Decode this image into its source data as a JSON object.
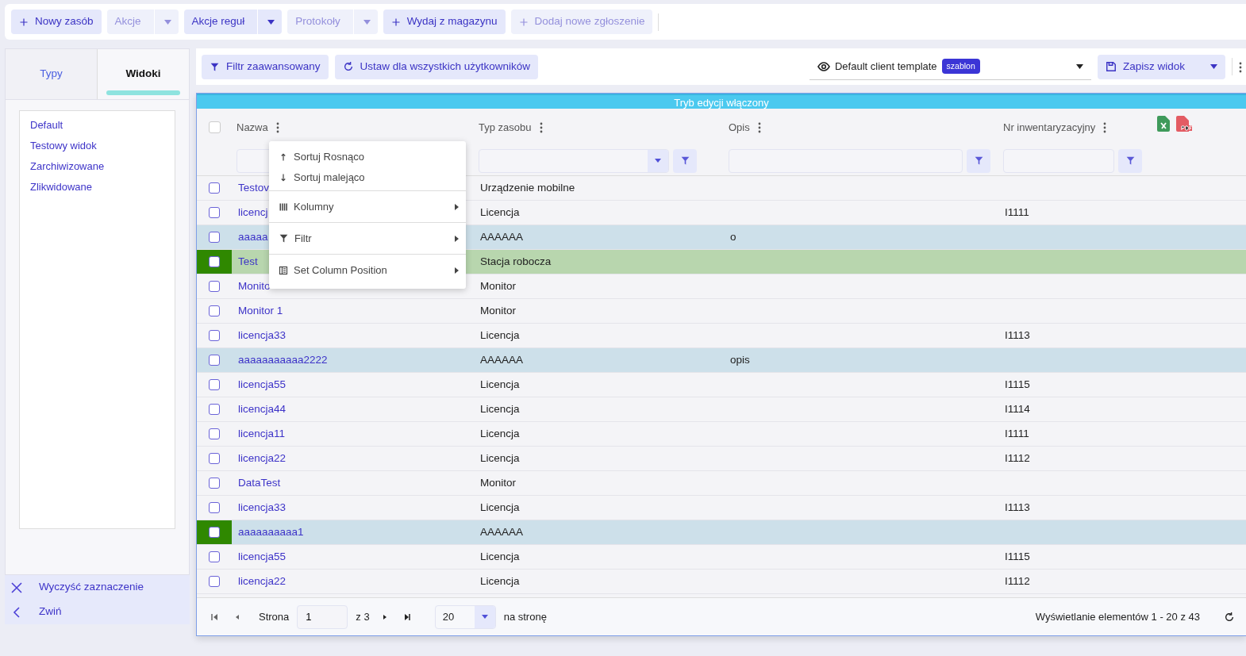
{
  "toolbar": {
    "buttons": [
      {
        "label": "Nowy zasób",
        "kind": "plus",
        "disabled": false
      },
      {
        "label": "Akcje",
        "kind": "split",
        "disabled": true
      },
      {
        "label": "Akcje reguł",
        "kind": "split",
        "disabled": false
      },
      {
        "label": "Protokoły",
        "kind": "split",
        "disabled": true
      },
      {
        "label": "Wydaj z magazynu",
        "kind": "plus",
        "disabled": false
      },
      {
        "label": "Dodaj nowe zgłoszenie",
        "kind": "plus",
        "disabled": true
      }
    ]
  },
  "side_tabs": [
    {
      "label": "Typy",
      "selected": false
    },
    {
      "label": "Widoki",
      "selected": true
    }
  ],
  "views": [
    "Default",
    "Testowy widok",
    "Zarchiwizowane",
    "Zlikwidowane"
  ],
  "side_actions": [
    {
      "label": "Wyczyść zaznaczenie",
      "kind": "close"
    },
    {
      "label": "Zwiń",
      "kind": "back"
    }
  ],
  "view_bar": {
    "buttons": [
      {
        "label": "Filtr zaawansowany",
        "kind": "filter"
      },
      {
        "label": "Ustaw dla wszystkich użytkowników",
        "kind": "refresh"
      }
    ],
    "template": {
      "value": "Default client template",
      "badge": "szablon"
    },
    "save": "Zapisz widok"
  },
  "banner": "Tryb edycji włączony",
  "table": {
    "columns": [
      {
        "label": "Nazwa",
        "kind": "text"
      },
      {
        "label": "Typ zasobu",
        "kind": "select"
      },
      {
        "label": "Opis",
        "kind": "text"
      },
      {
        "label": "Nr inwentaryzacyjny",
        "kind": "text"
      }
    ],
    "select_all_checked": false,
    "rows": [
      {
        "name": "Testov",
        "type": "Urządzenie mobilne",
        "checked": false,
        "marked": false
      },
      {
        "name": "licencj",
        "type": "Licencja",
        "inventory": "I1111",
        "checked": false,
        "marked": false
      },
      {
        "name": "aaaaa",
        "type": "AAAAAA",
        "description": "o",
        "color": "#cde0ea",
        "checked": false,
        "marked": false
      },
      {
        "name": "Test",
        "type": "Stacja robocza",
        "color": "#b8d6ae",
        "checked": false,
        "marked": true
      },
      {
        "name": "Monito",
        "type": "Monitor",
        "checked": false,
        "marked": false
      },
      {
        "name": "Monitor 1",
        "type": "Monitor",
        "checked": false,
        "marked": false
      },
      {
        "name": "licencja33",
        "type": "Licencja",
        "inventory": "I1113",
        "checked": false,
        "marked": false
      },
      {
        "name": "aaaaaaaaaaa2222",
        "type": "AAAAAA",
        "description": "opis",
        "color": "#cde0ea",
        "checked": false,
        "marked": false
      },
      {
        "name": "licencja55",
        "type": "Licencja",
        "inventory": "I1115",
        "checked": false,
        "marked": false
      },
      {
        "name": "licencja44",
        "type": "Licencja",
        "inventory": "I1114",
        "checked": false,
        "marked": false
      },
      {
        "name": "licencja11",
        "type": "Licencja",
        "inventory": "I1111",
        "checked": false,
        "marked": false
      },
      {
        "name": "licencja22",
        "type": "Licencja",
        "inventory": "I1112",
        "checked": false,
        "marked": false
      },
      {
        "name": "DataTest",
        "type": "Monitor",
        "checked": false,
        "marked": false
      },
      {
        "name": "licencja33",
        "type": "Licencja",
        "inventory": "I1113",
        "checked": false,
        "marked": false
      },
      {
        "name": "aaaaaaaaaa1",
        "type": "AAAAAA",
        "color": "#cde0ea",
        "checked": false,
        "marked": true
      },
      {
        "name": "licencja55",
        "type": "Licencja",
        "inventory": "I1115",
        "checked": false,
        "marked": false
      },
      {
        "name": "licencja22",
        "type": "Licencja",
        "inventory": "I1112",
        "checked": false,
        "marked": false
      }
    ]
  },
  "column_menu": {
    "groups": [
      [
        {
          "label": "Sortuj Rosnąco",
          "kind": "sort-up",
          "submenu": false
        },
        {
          "label": "Sortuj malejąco",
          "kind": "sort-down",
          "submenu": false
        }
      ],
      [
        {
          "label": "Kolumny",
          "kind": "columns",
          "submenu": true
        }
      ],
      [
        {
          "label": "Filtr",
          "kind": "filter",
          "submenu": true
        }
      ],
      [
        {
          "label": "Set Column Position",
          "kind": "position",
          "submenu": true
        }
      ]
    ]
  },
  "pager": {
    "page_label": "Strona",
    "page": "1",
    "of": "z 3",
    "page_size": "20",
    "per_page": "na stronę",
    "summary": "Wyświetlanie elementów 1 - 20 z 43"
  }
}
